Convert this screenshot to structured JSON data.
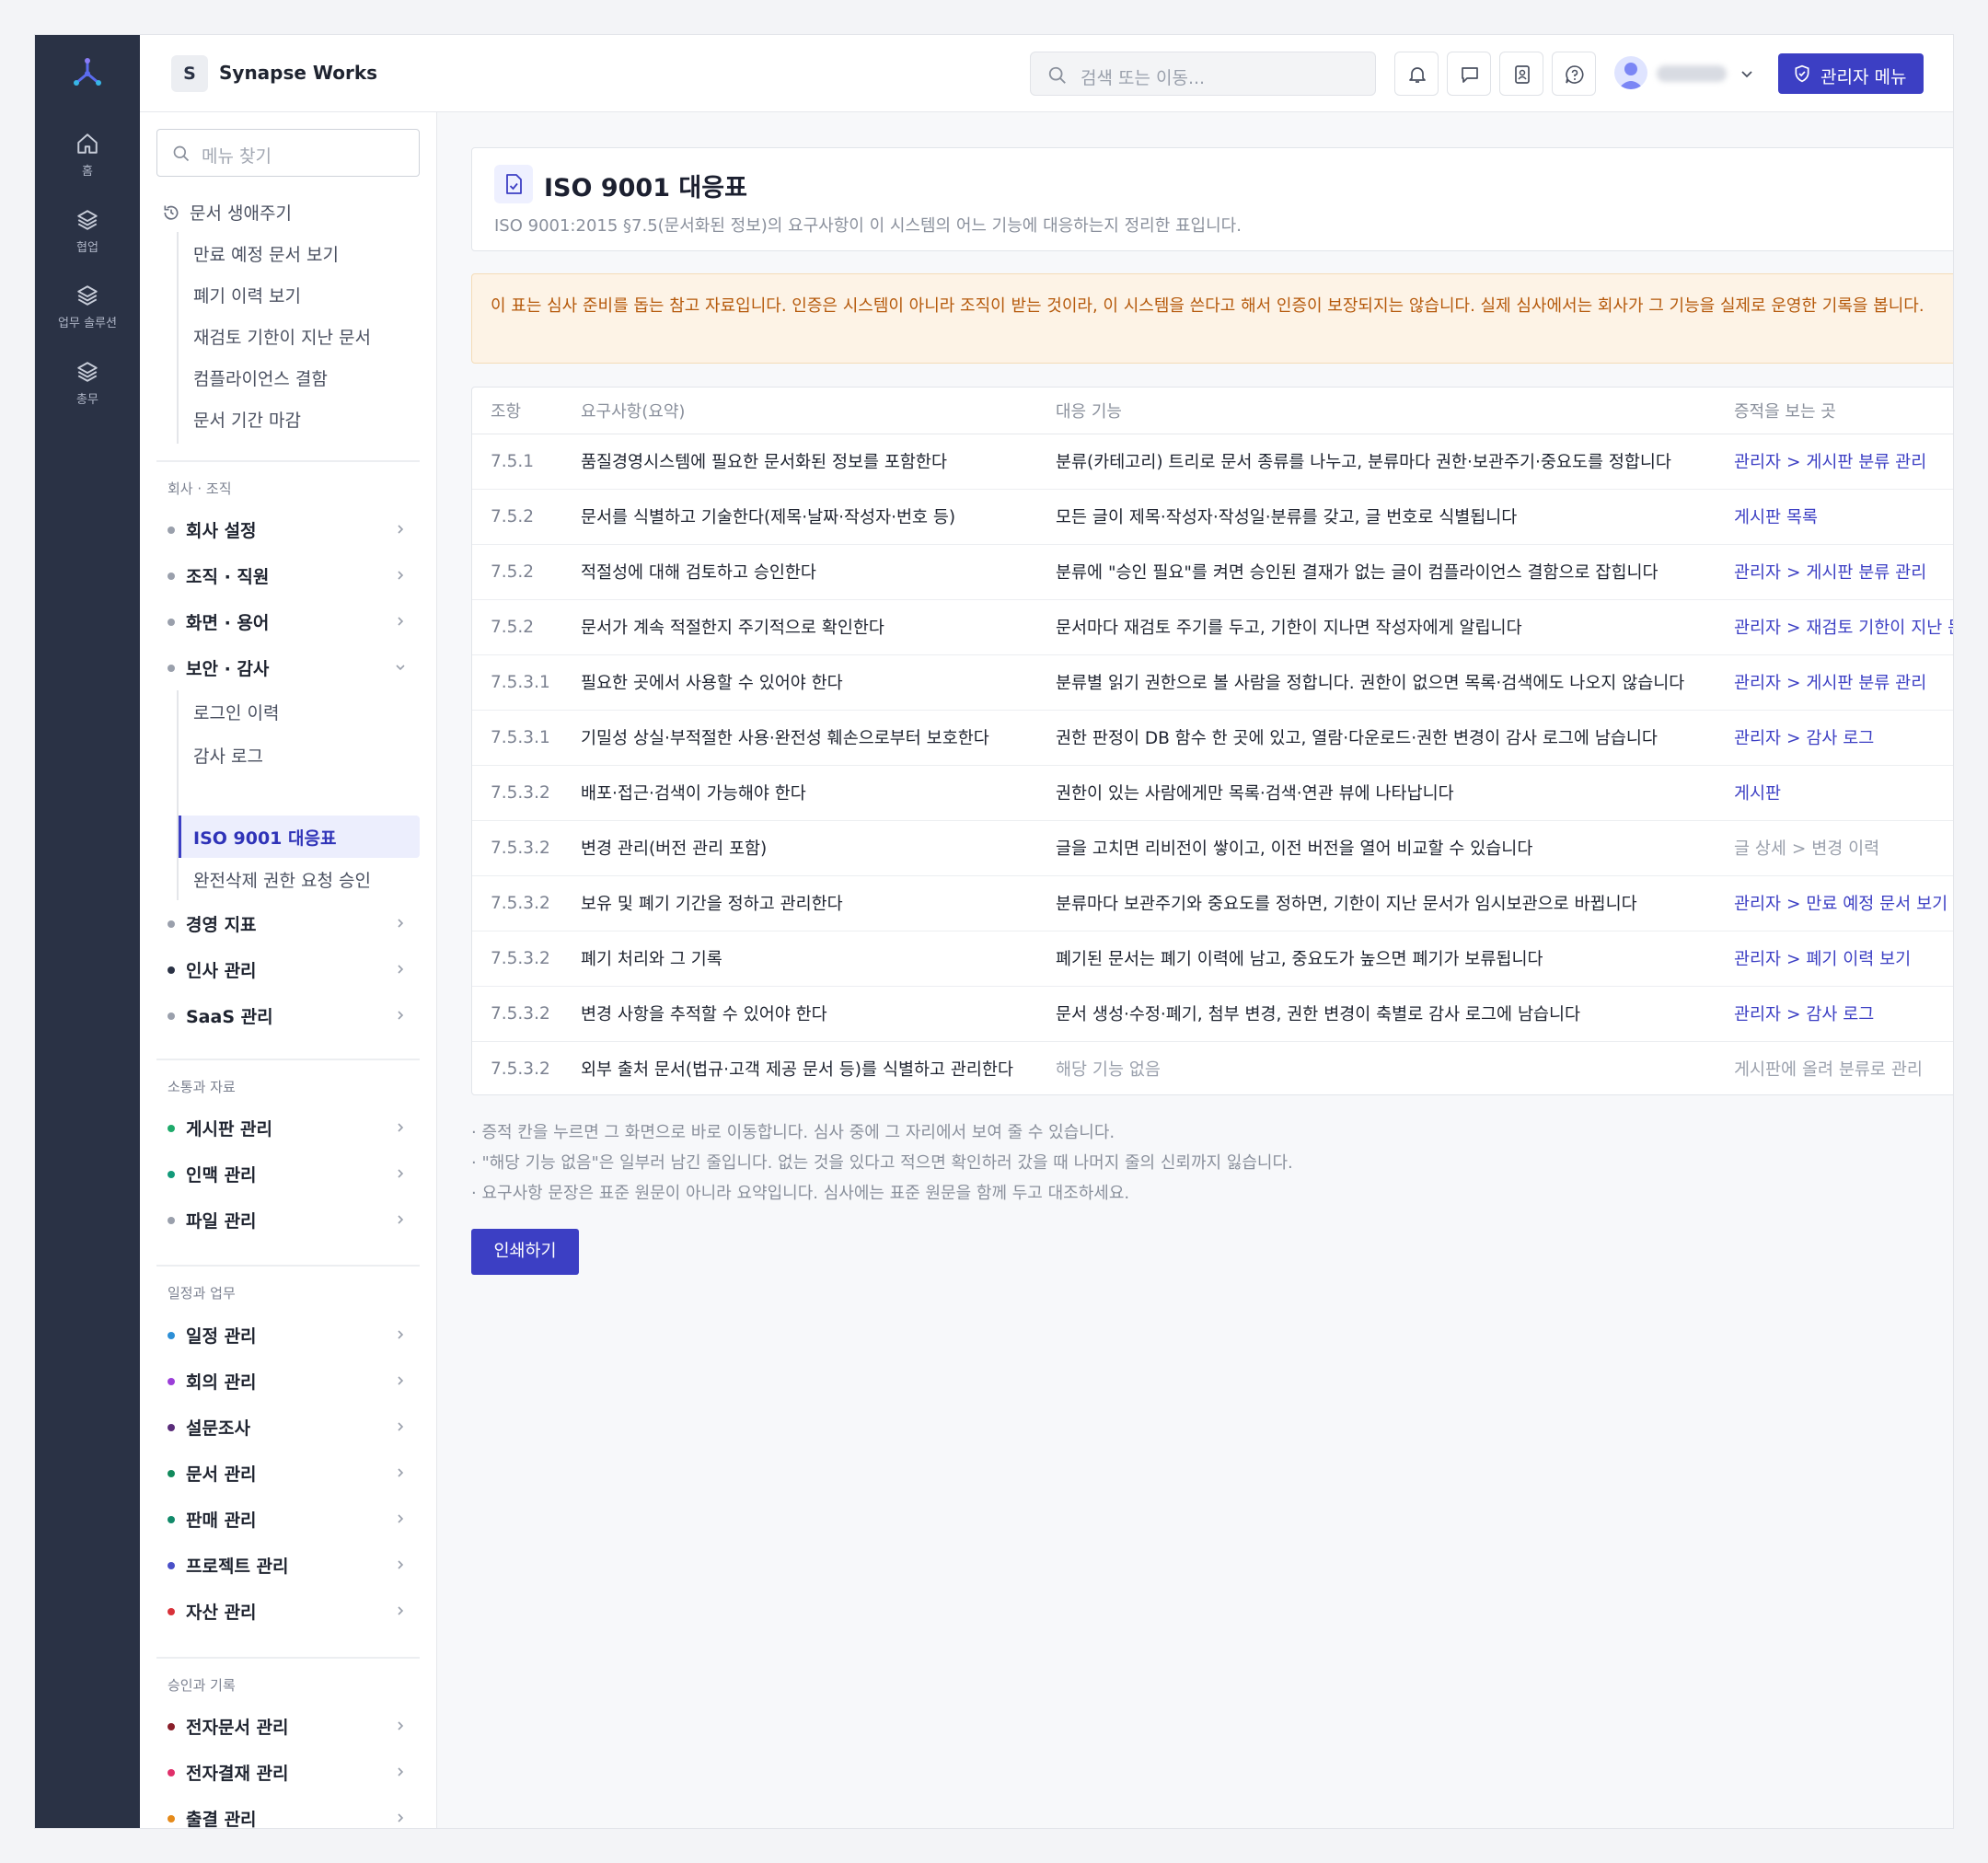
{
  "rail": {
    "items": [
      {
        "label": "홈",
        "icon": "home-icon"
      },
      {
        "label": "협업",
        "icon": "layers-icon"
      },
      {
        "label": "업무 솔루션",
        "icon": "layers-icon"
      },
      {
        "label": "총무",
        "icon": "layers-icon"
      }
    ]
  },
  "header": {
    "workspace_initial": "S",
    "workspace_name": "Synapse Works",
    "search_placeholder": "검색 또는 이동...",
    "admin_label": "관리자 메뉴"
  },
  "sidebar": {
    "search_placeholder": "메뉴 찾기",
    "lifecycle": {
      "title": "문서 생애주기",
      "items": [
        "만료 예정 문서 보기",
        "폐기 이력 보기",
        "재검토 기한이 지난 문서",
        "컴플라이언스 결함",
        "문서 기간 마감"
      ]
    },
    "sections": [
      {
        "label": "회사 · 조직",
        "items": [
          {
            "label": "회사 설정",
            "color": "#9aa0ac"
          },
          {
            "label": "조직 · 직원",
            "color": "#9aa0ac"
          },
          {
            "label": "화면 · 용어",
            "color": "#9aa0ac"
          },
          {
            "label": "보안 · 감사",
            "color": "#9aa0ac"
          }
        ],
        "security_sub": [
          "로그인 이력",
          "감사 로그",
          "ISO 9001 대응표",
          "완전삭제 권한 요청 승인"
        ],
        "after": [
          {
            "label": "경영 지표",
            "color": "#9aa0ac"
          },
          {
            "label": "인사 관리",
            "color": "#2a3245"
          },
          {
            "label": "SaaS 관리",
            "color": "#9aa0ac"
          }
        ]
      },
      {
        "label": "소통과 자료",
        "items": [
          {
            "label": "게시판 관리",
            "color": "#1faa6b"
          },
          {
            "label": "인맥 관리",
            "color": "#139a7a"
          },
          {
            "label": "파일 관리",
            "color": "#9aa0ac"
          }
        ]
      },
      {
        "label": "일정과 업무",
        "items": [
          {
            "label": "일정 관리",
            "color": "#2d8fd6"
          },
          {
            "label": "회의 관리",
            "color": "#9b3fd8"
          },
          {
            "label": "설문조사",
            "color": "#5a2d7a"
          },
          {
            "label": "문서 관리",
            "color": "#128a5c"
          },
          {
            "label": "판매 관리",
            "color": "#128a6a"
          },
          {
            "label": "프로젝트 관리",
            "color": "#4a50c8"
          },
          {
            "label": "자산 관리",
            "color": "#d8323a"
          }
        ]
      },
      {
        "label": "승인과 기록",
        "items": [
          {
            "label": "전자문서 관리",
            "color": "#8a1f2a"
          },
          {
            "label": "전자결재 관리",
            "color": "#e0306a"
          },
          {
            "label": "출결 관리",
            "color": "#e58a1a"
          }
        ]
      }
    ]
  },
  "main": {
    "title": "ISO 9001 대응표",
    "subtitle": "ISO 9001:2015 §7.5(문서화된 정보)의 요구사항이 이 시스템의 어느 기능에 대응하는지 정리한 표입니다.",
    "notice": "이 표는 심사 준비를 돕는 참고 자료입니다. 인증은 시스템이 아니라 조직이 받는 것이라, 이 시스템을 쓴다고 해서 인증이 보장되지는 않습니다. 실제 심사에서는 회사가 그 기능을 실제로 운영한 기록을 봅니다.",
    "columns": [
      "조항",
      "요구사항(요약)",
      "대응 기능",
      "증적을 보는 곳"
    ],
    "rows": [
      {
        "clause": "7.5.1",
        "req": "품질경영시스템에 필요한 문서화된 정보를 포함한다",
        "func": "분류(카테고리) 트리로 문서 종류를 나누고, 분류마다 권한·보관주기·중요도를 정합니다",
        "evidence": "관리자 > 게시판 분류 관리",
        "evidence_link": true,
        "func_muted": false
      },
      {
        "clause": "7.5.2",
        "req": "문서를 식별하고 기술한다(제목·날짜·작성자·번호 등)",
        "func": "모든 글이 제목·작성자·작성일·분류를 갖고, 글 번호로 식별됩니다",
        "evidence": "게시판 목록",
        "evidence_link": true,
        "func_muted": false
      },
      {
        "clause": "7.5.2",
        "req": "적절성에 대해 검토하고 승인한다",
        "func": "분류에 \"승인 필요\"를 켜면 승인된 결재가 없는 글이 컴플라이언스 결함으로 잡힙니다",
        "evidence": "관리자 > 게시판 분류 관리",
        "evidence_link": true,
        "func_muted": false
      },
      {
        "clause": "7.5.2",
        "req": "문서가 계속 적절한지 주기적으로 확인한다",
        "func": "문서마다 재검토 주기를 두고, 기한이 지나면 작성자에게 알립니다",
        "evidence": "관리자 > 재검토 기한이 지난 문서",
        "evidence_link": true,
        "func_muted": false
      },
      {
        "clause": "7.5.3.1",
        "req": "필요한 곳에서 사용할 수 있어야 한다",
        "func": "분류별 읽기 권한으로 볼 사람을 정합니다. 권한이 없으면 목록·검색에도 나오지 않습니다",
        "evidence": "관리자 > 게시판 분류 관리",
        "evidence_link": true,
        "func_muted": false
      },
      {
        "clause": "7.5.3.1",
        "req": "기밀성 상실·부적절한 사용·완전성 훼손으로부터 보호한다",
        "func": "권한 판정이 DB 함수 한 곳에 있고, 열람·다운로드·권한 변경이 감사 로그에 남습니다",
        "evidence": "관리자 > 감사 로그",
        "evidence_link": true,
        "func_muted": false
      },
      {
        "clause": "7.5.3.2",
        "req": "배포·접근·검색이 가능해야 한다",
        "func": "권한이 있는 사람에게만 목록·검색·연관 뷰에 나타납니다",
        "evidence": "게시판",
        "evidence_link": true,
        "func_muted": false
      },
      {
        "clause": "7.5.3.2",
        "req": "변경 관리(버전 관리 포함)",
        "func": "글을 고치면 리비전이 쌓이고, 이전 버전을 열어 비교할 수 있습니다",
        "evidence": "글 상세 > 변경 이력",
        "evidence_link": false,
        "func_muted": false
      },
      {
        "clause": "7.5.3.2",
        "req": "보유 및 폐기 기간을 정하고 관리한다",
        "func": "분류마다 보관주기와 중요도를 정하면, 기한이 지난 문서가 임시보관으로 바뀝니다",
        "evidence": "관리자 > 만료 예정 문서 보기",
        "evidence_link": true,
        "func_muted": false
      },
      {
        "clause": "7.5.3.2",
        "req": "폐기 처리와 그 기록",
        "func": "폐기된 문서는 폐기 이력에 남고, 중요도가 높으면 폐기가 보류됩니다",
        "evidence": "관리자 > 폐기 이력 보기",
        "evidence_link": true,
        "func_muted": false
      },
      {
        "clause": "7.5.3.2",
        "req": "변경 사항을 추적할 수 있어야 한다",
        "func": "문서 생성·수정·폐기, 첨부 변경, 권한 변경이 축별로 감사 로그에 남습니다",
        "evidence": "관리자 > 감사 로그",
        "evidence_link": true,
        "func_muted": false
      },
      {
        "clause": "7.5.3.2",
        "req": "외부 출처 문서(법규·고객 제공 문서 등)를 식별하고 관리한다",
        "func": "해당 기능 없음",
        "evidence": "게시판에 올려 분류로 관리",
        "evidence_link": false,
        "func_muted": true
      }
    ],
    "notes": [
      "· 증적 칸을 누르면 그 화면으로 바로 이동합니다. 심사 중에 그 자리에서 보여 줄 수 있습니다.",
      "· \"해당 기능 없음\"은 일부러 남긴 줄입니다. 없는 것을 있다고 적으면 확인하러 갔을 때 나머지 줄의 신뢰까지 잃습니다.",
      "· 요구사항 문장은 표준 원문이 아니라 요약입니다. 심사에는 표준 원문을 함께 두고 대조하세요."
    ],
    "print_label": "인쇄하기"
  }
}
